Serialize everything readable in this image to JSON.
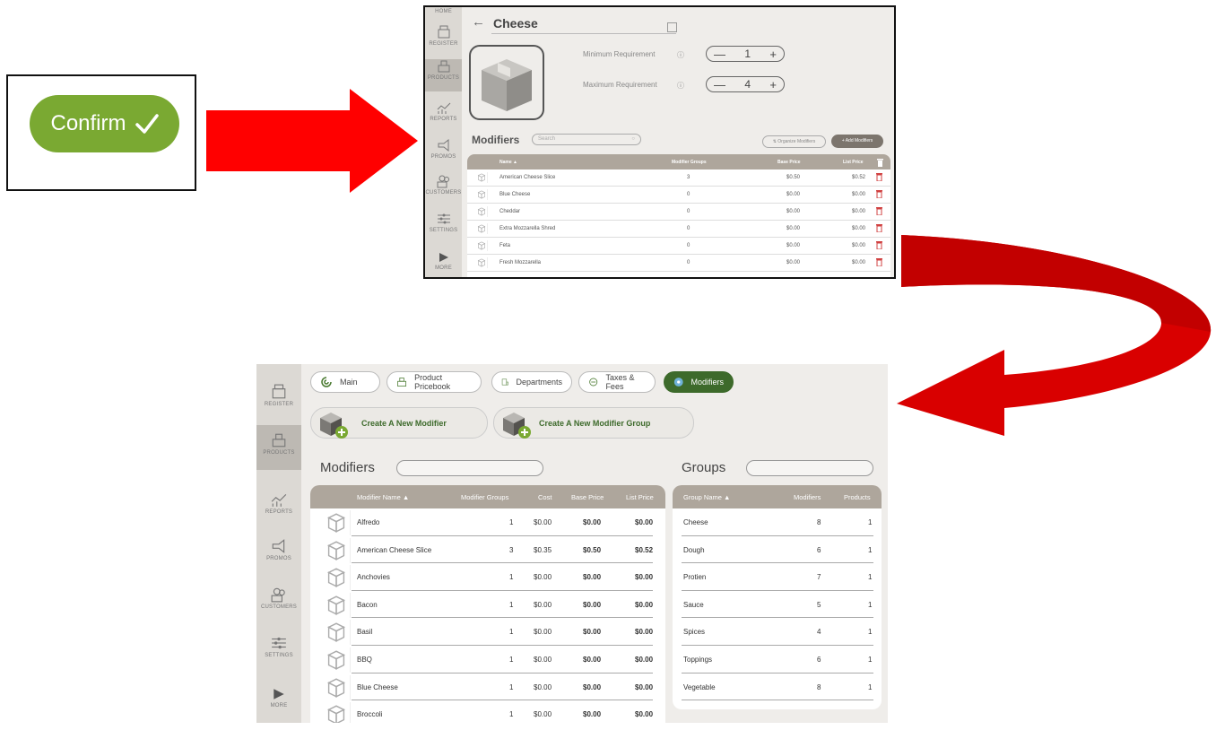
{
  "confirm": {
    "label": "Confirm"
  },
  "colors": {
    "accent_green": "#7aa932",
    "dark_green": "#3d6a2b",
    "arrow_red": "#ff0000",
    "table_head": "#aea69c"
  },
  "top_screen": {
    "sidebar": [
      "REGISTER",
      "PRODUCTS",
      "REPORTS",
      "PROMOS",
      "CUSTOMERS",
      "SETTINGS",
      "MORE"
    ],
    "sidebar_top_label": "HOME",
    "title": "Cheese",
    "min_label": "Minimum Requirement",
    "min_value": "1",
    "max_label": "Maximum Requirement",
    "max_value": "4",
    "modifiers_title": "Modifiers",
    "search_placeholder": "Search",
    "organize_label": "⇅ Organize Modifiers",
    "add_label": "+ Add Modifiers",
    "headers": {
      "name": "Name ▲",
      "groups": "Modifier Groups",
      "base": "Base Price",
      "list": "List Price"
    },
    "rows": [
      {
        "name": "American Cheese Slice",
        "groups": "3",
        "base": "$0.50",
        "list": "$0.52"
      },
      {
        "name": "Blue Cheese",
        "groups": "0",
        "base": "$0.00",
        "list": "$0.00"
      },
      {
        "name": "Cheddar",
        "groups": "0",
        "base": "$0.00",
        "list": "$0.00"
      },
      {
        "name": "Extra Mozzarella Shred",
        "groups": "0",
        "base": "$0.00",
        "list": "$0.00"
      },
      {
        "name": "Feta",
        "groups": "0",
        "base": "$0.00",
        "list": "$0.00"
      },
      {
        "name": "Fresh Mozzarella",
        "groups": "0",
        "base": "$0.00",
        "list": "$0.00"
      }
    ]
  },
  "bottom_screen": {
    "sidebar": [
      "REGISTER",
      "PRODUCTS",
      "REPORTS",
      "PROMOS",
      "CUSTOMERS",
      "SETTINGS",
      "MORE"
    ],
    "tabs": [
      "Main",
      "Product Pricebook",
      "Departments",
      "Taxes & Fees",
      "Modifiers"
    ],
    "create_modifier": "Create A New Modifier",
    "create_group": "Create A New Modifier Group",
    "modifiers_title": "Modifiers",
    "groups_title": "Groups",
    "mod_headers": {
      "name": "Modifier Name ▲",
      "groups": "Modifier Groups",
      "cost": "Cost",
      "base": "Base Price",
      "list": "List Price"
    },
    "mod_rows": [
      {
        "name": "Alfredo",
        "groups": "1",
        "cost": "$0.00",
        "base": "$0.00",
        "list": "$0.00"
      },
      {
        "name": "American Cheese Slice",
        "groups": "3",
        "cost": "$0.35",
        "base": "$0.50",
        "list": "$0.52"
      },
      {
        "name": "Anchovies",
        "groups": "1",
        "cost": "$0.00",
        "base": "$0.00",
        "list": "$0.00"
      },
      {
        "name": "Bacon",
        "groups": "1",
        "cost": "$0.00",
        "base": "$0.00",
        "list": "$0.00"
      },
      {
        "name": "Basil",
        "groups": "1",
        "cost": "$0.00",
        "base": "$0.00",
        "list": "$0.00"
      },
      {
        "name": "BBQ",
        "groups": "1",
        "cost": "$0.00",
        "base": "$0.00",
        "list": "$0.00"
      },
      {
        "name": "Blue Cheese",
        "groups": "1",
        "cost": "$0.00",
        "base": "$0.00",
        "list": "$0.00"
      },
      {
        "name": "Broccoli",
        "groups": "1",
        "cost": "$0.00",
        "base": "$0.00",
        "list": "$0.00"
      }
    ],
    "group_headers": {
      "name": "Group Name ▲",
      "modifiers": "Modifiers",
      "products": "Products"
    },
    "group_rows": [
      {
        "name": "Cheese",
        "modifiers": "8",
        "products": "1"
      },
      {
        "name": "Dough",
        "modifiers": "6",
        "products": "1"
      },
      {
        "name": "Protien",
        "modifiers": "7",
        "products": "1"
      },
      {
        "name": "Sauce",
        "modifiers": "5",
        "products": "1"
      },
      {
        "name": "Spices",
        "modifiers": "4",
        "products": "1"
      },
      {
        "name": "Toppings",
        "modifiers": "6",
        "products": "1"
      },
      {
        "name": "Vegetable",
        "modifiers": "8",
        "products": "1"
      }
    ]
  }
}
